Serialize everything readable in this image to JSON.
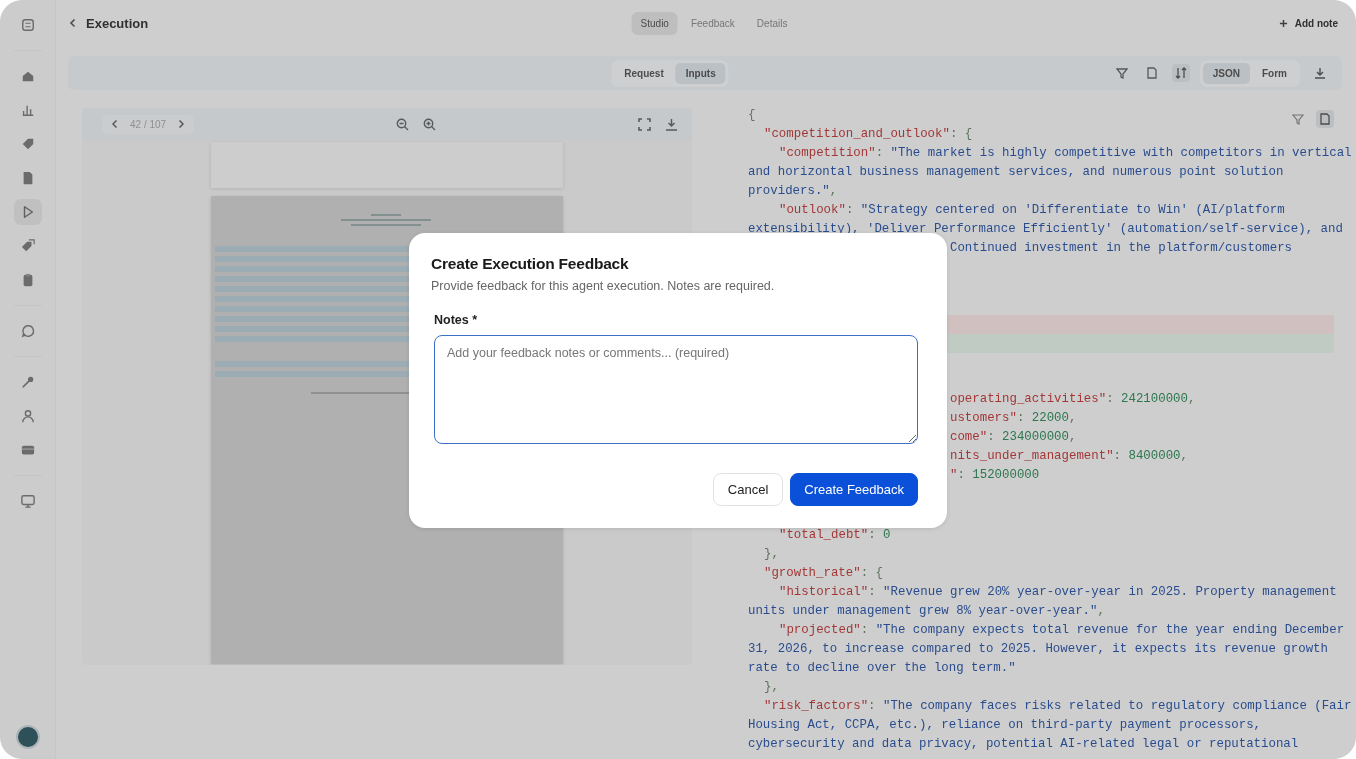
{
  "sidebar": {
    "items": [
      {
        "kind": "logo",
        "selected": false
      },
      {
        "kind": "home",
        "selected": false
      },
      {
        "kind": "chart",
        "selected": false
      },
      {
        "kind": "tag",
        "selected": false
      },
      {
        "kind": "document",
        "selected": false
      },
      {
        "kind": "play",
        "selected": true
      },
      {
        "kind": "tags",
        "selected": false
      },
      {
        "kind": "clipboard",
        "selected": false
      },
      {
        "kind": "chat",
        "selected": false
      },
      {
        "kind": "key",
        "selected": false
      },
      {
        "kind": "user",
        "selected": false
      },
      {
        "kind": "card",
        "selected": false
      },
      {
        "kind": "monitor",
        "selected": false
      }
    ]
  },
  "header": {
    "back_label": "Execution",
    "tabs": [
      {
        "label": "Studio",
        "selected": true
      },
      {
        "label": "Feedback",
        "selected": false
      },
      {
        "label": "Details",
        "selected": false
      }
    ],
    "add_note": "Add note"
  },
  "toolbar": {
    "source_tabs": [
      {
        "label": "Request",
        "selected": false
      },
      {
        "label": "Inputs",
        "selected": true
      }
    ],
    "view_tabs": [
      {
        "label": "JSON",
        "selected": true
      },
      {
        "label": "Form",
        "selected": false
      }
    ]
  },
  "viewer": {
    "page_indicator": "42 / 107"
  },
  "code": {
    "top_lines": [
      {
        "kind": "root",
        "parts": [
          {
            "kind": "punct",
            "text": "{"
          }
        ]
      },
      {
        "kind": "depth1",
        "parts": [
          {
            "kind": "key",
            "text": "\"competition_and_outlook\""
          },
          {
            "kind": "punct",
            "text": ": {"
          }
        ]
      },
      {
        "kind": "depth2",
        "parts": [
          {
            "kind": "key",
            "text": "\"competition\""
          },
          {
            "kind": "punct",
            "text": ": "
          },
          {
            "kind": "string",
            "text": "\"The market is highly competitive with competitors in vertical"
          }
        ]
      },
      {
        "kind": "root",
        "parts": [
          {
            "kind": "string",
            "text": "and horizontal business management services, and numerous point solution"
          }
        ]
      },
      {
        "kind": "root",
        "parts": [
          {
            "kind": "string",
            "text": "providers.\""
          },
          {
            "kind": "punct",
            "text": ","
          }
        ]
      },
      {
        "kind": "depth2",
        "parts": [
          {
            "kind": "key",
            "text": "\"outlook\""
          },
          {
            "kind": "punct",
            "text": ": "
          },
          {
            "kind": "string",
            "text": "\"Strategy centered on 'Differentiate to Win' (AI/platform"
          }
        ]
      },
      {
        "kind": "root",
        "parts": [
          {
            "kind": "string",
            "text": "extensibility), 'Deliver Performance Efficiently' (automation/self-service), and"
          }
        ]
      },
      {
        "kind": "tail",
        "parts": [
          {
            "kind": "string",
            "text": "Continued investment in the platform/customers"
          }
        ]
      }
    ],
    "diff_rows": [
      {
        "kind": "removed"
      },
      {
        "kind": "added"
      }
    ],
    "middle_lines": [
      {
        "kind": "tail",
        "parts": [
          {
            "kind": "key",
            "text": "operating_activities\""
          },
          {
            "kind": "punct",
            "text": ": "
          },
          {
            "kind": "number",
            "text": "242100000"
          },
          {
            "kind": "punct",
            "text": ","
          }
        ]
      },
      {
        "kind": "tail",
        "parts": [
          {
            "kind": "key",
            "text": "ustomers\""
          },
          {
            "kind": "punct",
            "text": ": "
          },
          {
            "kind": "number",
            "text": "22000"
          },
          {
            "kind": "punct",
            "text": ","
          }
        ]
      },
      {
        "kind": "tail",
        "parts": [
          {
            "kind": "key",
            "text": "come\""
          },
          {
            "kind": "punct",
            "text": ": "
          },
          {
            "kind": "number",
            "text": "234000000"
          },
          {
            "kind": "punct",
            "text": ","
          }
        ]
      },
      {
        "kind": "tail",
        "parts": [
          {
            "kind": "key",
            "text": "nits_under_management\""
          },
          {
            "kind": "punct",
            "text": ": "
          },
          {
            "kind": "number",
            "text": "8400000"
          },
          {
            "kind": "punct",
            "text": ","
          }
        ]
      },
      {
        "kind": "tail",
        "parts": [
          {
            "kind": "key",
            "text": "\""
          },
          {
            "kind": "punct",
            "text": ": "
          },
          {
            "kind": "number",
            "text": "152000000"
          }
        ]
      }
    ],
    "bottom_lines": [
      {
        "kind": "depth2",
        "parts": [
          {
            "kind": "key",
            "text": "\"total_debt\""
          },
          {
            "kind": "punct",
            "text": ": "
          },
          {
            "kind": "number",
            "text": "0"
          }
        ]
      },
      {
        "kind": "depth1",
        "parts": [
          {
            "kind": "punct",
            "text": "},"
          }
        ]
      },
      {
        "kind": "depth1",
        "parts": [
          {
            "kind": "key",
            "text": "\"growth_rate\""
          },
          {
            "kind": "punct",
            "text": ": {"
          }
        ]
      },
      {
        "kind": "depth2",
        "parts": [
          {
            "kind": "key",
            "text": "\"historical\""
          },
          {
            "kind": "punct",
            "text": ": "
          },
          {
            "kind": "string",
            "text": "\"Revenue grew 20% year-over-year in 2025. Property management"
          }
        ]
      },
      {
        "kind": "root",
        "parts": [
          {
            "kind": "string",
            "text": "units under management grew 8% year-over-year.\""
          },
          {
            "kind": "punct",
            "text": ","
          }
        ]
      },
      {
        "kind": "depth2",
        "parts": [
          {
            "kind": "key",
            "text": "\"projected\""
          },
          {
            "kind": "punct",
            "text": ": "
          },
          {
            "kind": "string",
            "text": "\"The company expects total revenue for the year ending December"
          }
        ]
      },
      {
        "kind": "root",
        "parts": [
          {
            "kind": "string",
            "text": "31, 2026, to increase compared to 2025. However, it expects its revenue growth"
          }
        ]
      },
      {
        "kind": "root",
        "parts": [
          {
            "kind": "string",
            "text": "rate to decline over the long term.\""
          }
        ]
      },
      {
        "kind": "depth1",
        "parts": [
          {
            "kind": "punct",
            "text": "},"
          }
        ]
      },
      {
        "kind": "depth1",
        "parts": [
          {
            "kind": "key",
            "text": "\"risk_factors\""
          },
          {
            "kind": "punct",
            "text": ": "
          },
          {
            "kind": "string",
            "text": "\"The company faces risks related to regulatory compliance (Fair"
          }
        ]
      },
      {
        "kind": "root",
        "parts": [
          {
            "kind": "string",
            "text": "Housing Act, CCPA, etc.), reliance on third-party payment processors,"
          }
        ]
      },
      {
        "kind": "root",
        "parts": [
          {
            "kind": "string",
            "text": "cybersecurity and data privacy, potential AI-related legal or reputational"
          }
        ]
      }
    ]
  },
  "dialog": {
    "title": "Create Execution Feedback",
    "description": "Provide feedback for this agent execution. Notes are required.",
    "notes_label": "Notes *",
    "notes_placeholder": "Add your feedback notes or comments... (required)",
    "buttons": [
      {
        "kind": "secondary",
        "label": "Cancel"
      },
      {
        "kind": "primary",
        "label": "Create Feedback"
      }
    ]
  }
}
